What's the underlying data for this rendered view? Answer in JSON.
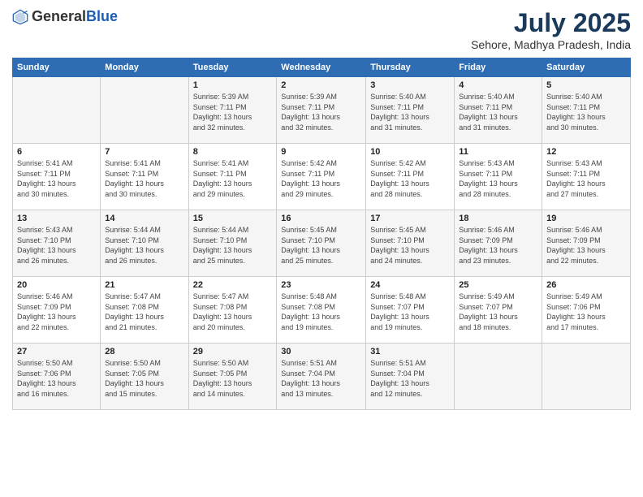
{
  "header": {
    "logo_general": "General",
    "logo_blue": "Blue",
    "month_year": "July 2025",
    "location": "Sehore, Madhya Pradesh, India"
  },
  "days_of_week": [
    "Sunday",
    "Monday",
    "Tuesday",
    "Wednesday",
    "Thursday",
    "Friday",
    "Saturday"
  ],
  "weeks": [
    [
      {
        "day": "",
        "info": ""
      },
      {
        "day": "",
        "info": ""
      },
      {
        "day": "1",
        "info": "Sunrise: 5:39 AM\nSunset: 7:11 PM\nDaylight: 13 hours\nand 32 minutes."
      },
      {
        "day": "2",
        "info": "Sunrise: 5:39 AM\nSunset: 7:11 PM\nDaylight: 13 hours\nand 32 minutes."
      },
      {
        "day": "3",
        "info": "Sunrise: 5:40 AM\nSunset: 7:11 PM\nDaylight: 13 hours\nand 31 minutes."
      },
      {
        "day": "4",
        "info": "Sunrise: 5:40 AM\nSunset: 7:11 PM\nDaylight: 13 hours\nand 31 minutes."
      },
      {
        "day": "5",
        "info": "Sunrise: 5:40 AM\nSunset: 7:11 PM\nDaylight: 13 hours\nand 30 minutes."
      }
    ],
    [
      {
        "day": "6",
        "info": "Sunrise: 5:41 AM\nSunset: 7:11 PM\nDaylight: 13 hours\nand 30 minutes."
      },
      {
        "day": "7",
        "info": "Sunrise: 5:41 AM\nSunset: 7:11 PM\nDaylight: 13 hours\nand 30 minutes."
      },
      {
        "day": "8",
        "info": "Sunrise: 5:41 AM\nSunset: 7:11 PM\nDaylight: 13 hours\nand 29 minutes."
      },
      {
        "day": "9",
        "info": "Sunrise: 5:42 AM\nSunset: 7:11 PM\nDaylight: 13 hours\nand 29 minutes."
      },
      {
        "day": "10",
        "info": "Sunrise: 5:42 AM\nSunset: 7:11 PM\nDaylight: 13 hours\nand 28 minutes."
      },
      {
        "day": "11",
        "info": "Sunrise: 5:43 AM\nSunset: 7:11 PM\nDaylight: 13 hours\nand 28 minutes."
      },
      {
        "day": "12",
        "info": "Sunrise: 5:43 AM\nSunset: 7:11 PM\nDaylight: 13 hours\nand 27 minutes."
      }
    ],
    [
      {
        "day": "13",
        "info": "Sunrise: 5:43 AM\nSunset: 7:10 PM\nDaylight: 13 hours\nand 26 minutes."
      },
      {
        "day": "14",
        "info": "Sunrise: 5:44 AM\nSunset: 7:10 PM\nDaylight: 13 hours\nand 26 minutes."
      },
      {
        "day": "15",
        "info": "Sunrise: 5:44 AM\nSunset: 7:10 PM\nDaylight: 13 hours\nand 25 minutes."
      },
      {
        "day": "16",
        "info": "Sunrise: 5:45 AM\nSunset: 7:10 PM\nDaylight: 13 hours\nand 25 minutes."
      },
      {
        "day": "17",
        "info": "Sunrise: 5:45 AM\nSunset: 7:10 PM\nDaylight: 13 hours\nand 24 minutes."
      },
      {
        "day": "18",
        "info": "Sunrise: 5:46 AM\nSunset: 7:09 PM\nDaylight: 13 hours\nand 23 minutes."
      },
      {
        "day": "19",
        "info": "Sunrise: 5:46 AM\nSunset: 7:09 PM\nDaylight: 13 hours\nand 22 minutes."
      }
    ],
    [
      {
        "day": "20",
        "info": "Sunrise: 5:46 AM\nSunset: 7:09 PM\nDaylight: 13 hours\nand 22 minutes."
      },
      {
        "day": "21",
        "info": "Sunrise: 5:47 AM\nSunset: 7:08 PM\nDaylight: 13 hours\nand 21 minutes."
      },
      {
        "day": "22",
        "info": "Sunrise: 5:47 AM\nSunset: 7:08 PM\nDaylight: 13 hours\nand 20 minutes."
      },
      {
        "day": "23",
        "info": "Sunrise: 5:48 AM\nSunset: 7:08 PM\nDaylight: 13 hours\nand 19 minutes."
      },
      {
        "day": "24",
        "info": "Sunrise: 5:48 AM\nSunset: 7:07 PM\nDaylight: 13 hours\nand 19 minutes."
      },
      {
        "day": "25",
        "info": "Sunrise: 5:49 AM\nSunset: 7:07 PM\nDaylight: 13 hours\nand 18 minutes."
      },
      {
        "day": "26",
        "info": "Sunrise: 5:49 AM\nSunset: 7:06 PM\nDaylight: 13 hours\nand 17 minutes."
      }
    ],
    [
      {
        "day": "27",
        "info": "Sunrise: 5:50 AM\nSunset: 7:06 PM\nDaylight: 13 hours\nand 16 minutes."
      },
      {
        "day": "28",
        "info": "Sunrise: 5:50 AM\nSunset: 7:05 PM\nDaylight: 13 hours\nand 15 minutes."
      },
      {
        "day": "29",
        "info": "Sunrise: 5:50 AM\nSunset: 7:05 PM\nDaylight: 13 hours\nand 14 minutes."
      },
      {
        "day": "30",
        "info": "Sunrise: 5:51 AM\nSunset: 7:04 PM\nDaylight: 13 hours\nand 13 minutes."
      },
      {
        "day": "31",
        "info": "Sunrise: 5:51 AM\nSunset: 7:04 PM\nDaylight: 13 hours\nand 12 minutes."
      },
      {
        "day": "",
        "info": ""
      },
      {
        "day": "",
        "info": ""
      }
    ]
  ]
}
